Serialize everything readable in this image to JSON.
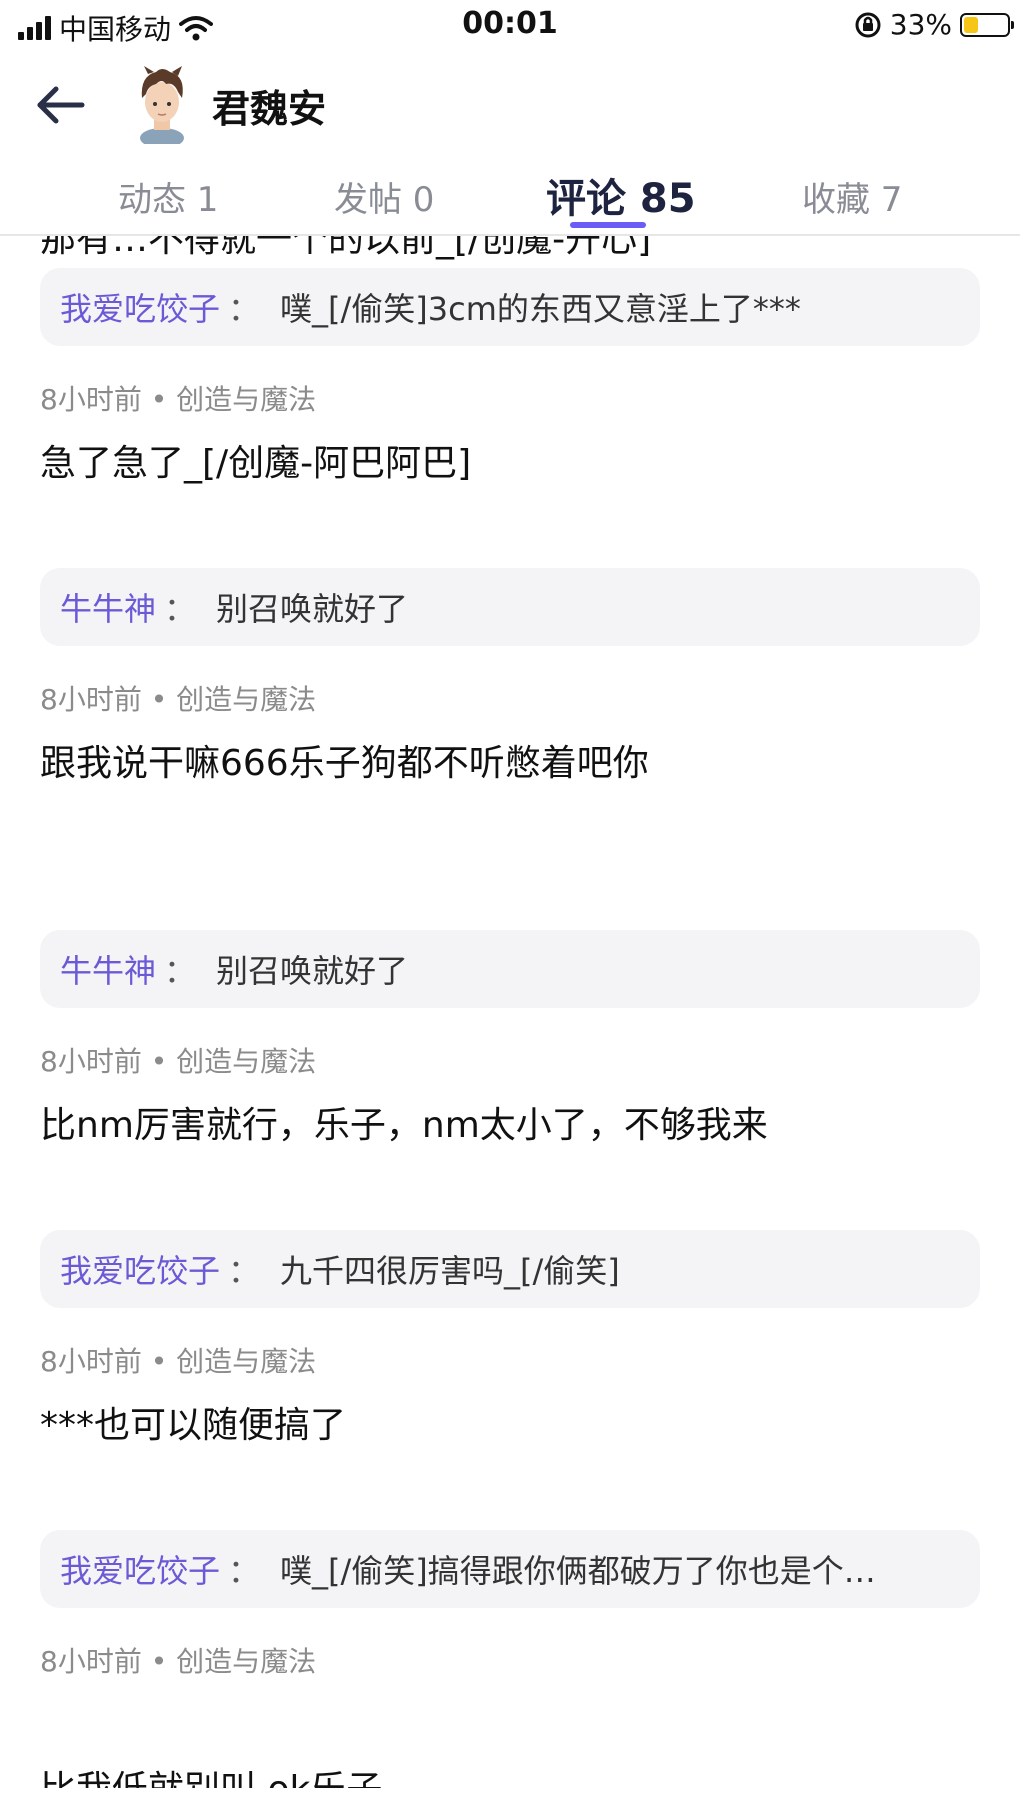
{
  "status": {
    "carrier": "中国移动",
    "time": "00:01",
    "battery": "33%",
    "battery_level": 0.33,
    "battery_color": "#f5c518"
  },
  "header": {
    "back_icon": "arrow-left-icon",
    "username": "君魏安"
  },
  "tabs": [
    {
      "label": "动态 1"
    },
    {
      "label": "发帖 0"
    },
    {
      "label": "评论 85"
    },
    {
      "label": "收藏 7"
    }
  ],
  "accent_color": "#6b5cf5",
  "partial_post": "那有…不得就一个的以前_[/创魔-开心]",
  "first_reply": {
    "name": "我爱吃饺子",
    "sep": "：",
    "text": "噗_[/偷笑]3cm的东西又意淫上了***"
  },
  "posts": [
    {
      "meta": "8小时前 • 创造与魔法",
      "text": "急了急了_[/创魔-阿巴阿巴]",
      "reply": {
        "name": "牛牛神",
        "sep": "：",
        "text": "别召唤就好了"
      }
    },
    {
      "meta": "8小时前 • 创造与魔法",
      "text": "跟我说干嘛666乐子狗都不听憋着吧你",
      "reply": {
        "name": "牛牛神",
        "sep": "：",
        "text": "别召唤就好了"
      }
    },
    {
      "meta": "8小时前 • 创造与魔法",
      "text": "比nm厉害就行，乐子，nm太小了，不够我来",
      "reply": {
        "name": "我爱吃饺子",
        "sep": "：",
        "text": "九千四很厉害吗_[/偷笑]"
      }
    },
    {
      "meta": "8小时前 • 创造与魔法",
      "text": "***也可以随便搞了",
      "reply": {
        "name": "我爱吃饺子",
        "sep": "：",
        "text": "噗_[/偷笑]搞得跟你俩都破万了你也是个…"
      }
    },
    {
      "meta": "8小时前 • 创造与魔法",
      "text": "比我低就别叫 ok乐子"
    }
  ]
}
